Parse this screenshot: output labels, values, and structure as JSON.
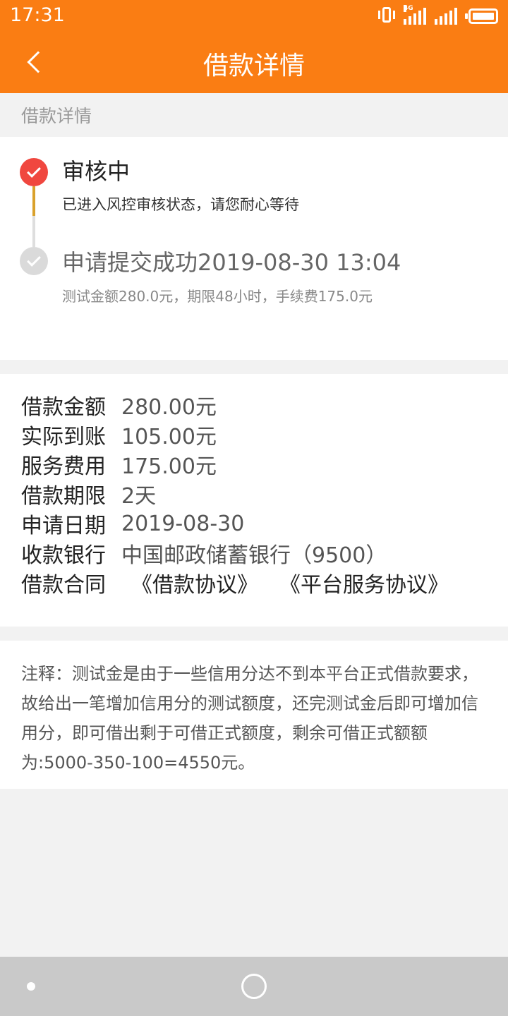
{
  "status_bar": {
    "time": "17:31",
    "network_tag": "4G",
    "icons": [
      "vibrate-icon",
      "signal-4g-icon",
      "signal-icon",
      "battery-icon"
    ]
  },
  "nav": {
    "title": "借款详情",
    "back_icon": "chevron-left-icon"
  },
  "section_header": "借款详情",
  "timeline": [
    {
      "title": "审核中",
      "desc": "已进入风控审核状态，请您耐心等待",
      "state": "active",
      "color": "#f0473f"
    },
    {
      "title": "申请提交成功2019-08-30 13:04",
      "desc": "测试金额280.0元，期限48小时，手续费175.0元",
      "state": "done",
      "color": "#dadada"
    }
  ],
  "details": [
    {
      "label": "借款金额",
      "value": "280.00元"
    },
    {
      "label": "实际到账",
      "value": "105.00元"
    },
    {
      "label": "服务费用",
      "value": "175.00元"
    },
    {
      "label": "借款期限",
      "value": "2天"
    },
    {
      "label": "申请日期",
      "value": "2019-08-30"
    },
    {
      "label": "收款银行",
      "value": "中国邮政储蓄银行（9500）"
    }
  ],
  "contract": {
    "label": "借款合同",
    "links": [
      "《借款协议》",
      "《平台服务协议》"
    ]
  },
  "note": "注释：测试金是由于一些信用分达不到本平台正式借款要求，故给出一笔增加信用分的测试额度，还完测试金后即可增加信用分，即可借出剩于可借正式额度，剩余可借正式额额为:5000-350-100=4550元。",
  "colors": {
    "brand_orange": "#fa7d13",
    "active_red": "#f0473f",
    "line_gold": "#d9a12c",
    "background": "#f2f2f2"
  }
}
